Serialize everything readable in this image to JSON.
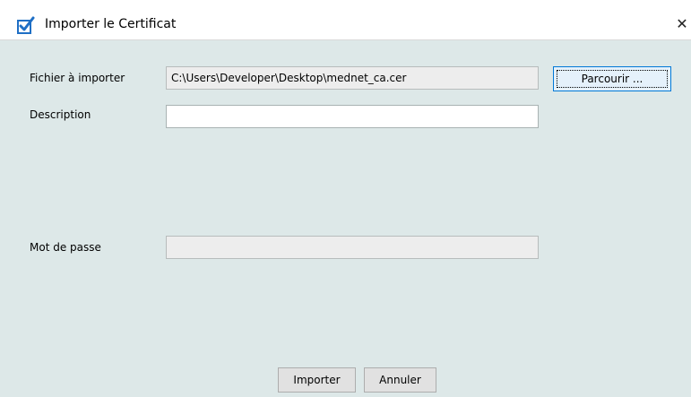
{
  "window": {
    "title": "Importer le Certificat",
    "close_label": "✕",
    "icon": "checkmark-icon"
  },
  "form": {
    "file_label": "Fichier à importer",
    "file_value": "C:\\Users\\Developer\\Desktop\\mednet_ca.cer",
    "browse_label": "Parcourir ...",
    "description_label": "Description",
    "description_value": "",
    "password_label": "Mot de passe",
    "password_value": ""
  },
  "actions": {
    "import_label": "Importer",
    "cancel_label": "Annuler"
  },
  "colors": {
    "background": "#dde8e8",
    "titlebar": "#ffffff",
    "accent": "#0078d7"
  }
}
